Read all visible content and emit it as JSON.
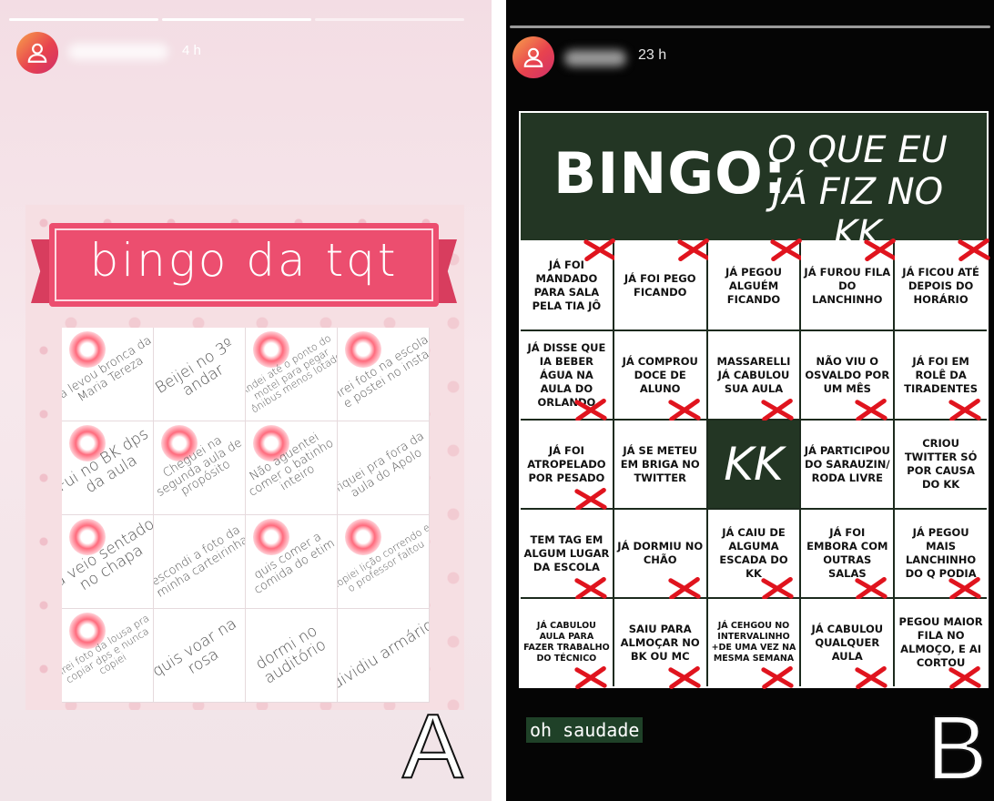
{
  "panel_a": {
    "time": "4 h",
    "label": "A",
    "title": "bingo da tqt",
    "cells": [
      "já levou bronca da Maria Tereza",
      "Beijei no 3º andar",
      "Andei até o ponto do motel para pegar ônibus menos lotado",
      "Tirei foto na escola e postei no insta",
      "Fui no BK dps da aula",
      "Cheguei na segunda aula de propósito",
      "Não aguentei comer o batinho inteiro",
      "fiquei pra fora da aula do Apolo",
      "ja veio sentado no chapa",
      "escondi a foto da minha carteirinha",
      "quis comer a comida do etim",
      "Copiei lição correndo e o professor faltou",
      "Tirei foto da lousa pra copiar dps e nunca copiei",
      "quis voar na rosa",
      "dormi no auditório",
      "dividiu armário"
    ],
    "marked": [
      true,
      false,
      true,
      true,
      true,
      true,
      true,
      false,
      true,
      false,
      true,
      true,
      true,
      false,
      false,
      false
    ]
  },
  "panel_b": {
    "time": "23 h",
    "label": "B",
    "title": "BINGO:",
    "subtitle": "O QUE EU JÁ FIZ NO KK",
    "caption": "oh saudade",
    "cells": [
      "JÁ FOI MANDADO PARA SALA PELA TIA JÔ",
      "JÁ FOI PEGO FICANDO",
      "JÁ PEGOU ALGUÉM FICANDO",
      "JÁ FUROU FILA DO LANCHINHO",
      "JÁ FICOU ATÉ DEPOIS DO HORÁRIO",
      "JÁ DISSE QUE IA BEBER ÁGUA NA AULA DO ORLANDO",
      "JÁ COMPROU DOCE DE ALUNO",
      "MASSARELLI JÁ CABULOU SUA AULA",
      "NÃO VIU O OSVALDO POR UM MÊS",
      "JÁ FOI EM ROLÊ DA TIRADENTES",
      "JÁ FOI ATROPELADO POR PESADO",
      "JÁ SE METEU EM BRIGA NO TWITTER",
      "KK",
      "JÁ PARTICIPOU DO SARAUZIN/ RODA LIVRE",
      "CRIOU TWITTER SÓ POR CAUSA DO KK",
      "TEM TAG EM ALGUM LUGAR DA ESCOLA",
      "JÁ DORMIU NO CHÃO",
      "JÁ CAIU DE ALGUMA ESCADA DO KK",
      "JÁ FOI EMBORA COM OUTRAS SALAS",
      "JÁ PEGOU MAIS LANCHINHO DO Q PODIA",
      "JÁ CABULOU AULA PARA FAZER TRABALHO DO TÉCNICO",
      "SAIU PARA ALMOÇAR NO BK OU MC",
      "JÁ CEHGOU NO INTERVALINHO +DE UMA VEZ NA MESMA SEMANA",
      "JÁ CABULOU QUALQUER AULA",
      "PEGOU MAIOR FILA NO ALMOÇO, E AI CORTOU"
    ],
    "marked": [
      true,
      true,
      true,
      true,
      true,
      true,
      true,
      true,
      true,
      true,
      true,
      false,
      false,
      false,
      false,
      true,
      true,
      true,
      true,
      true,
      true,
      true,
      true,
      true,
      true
    ]
  }
}
